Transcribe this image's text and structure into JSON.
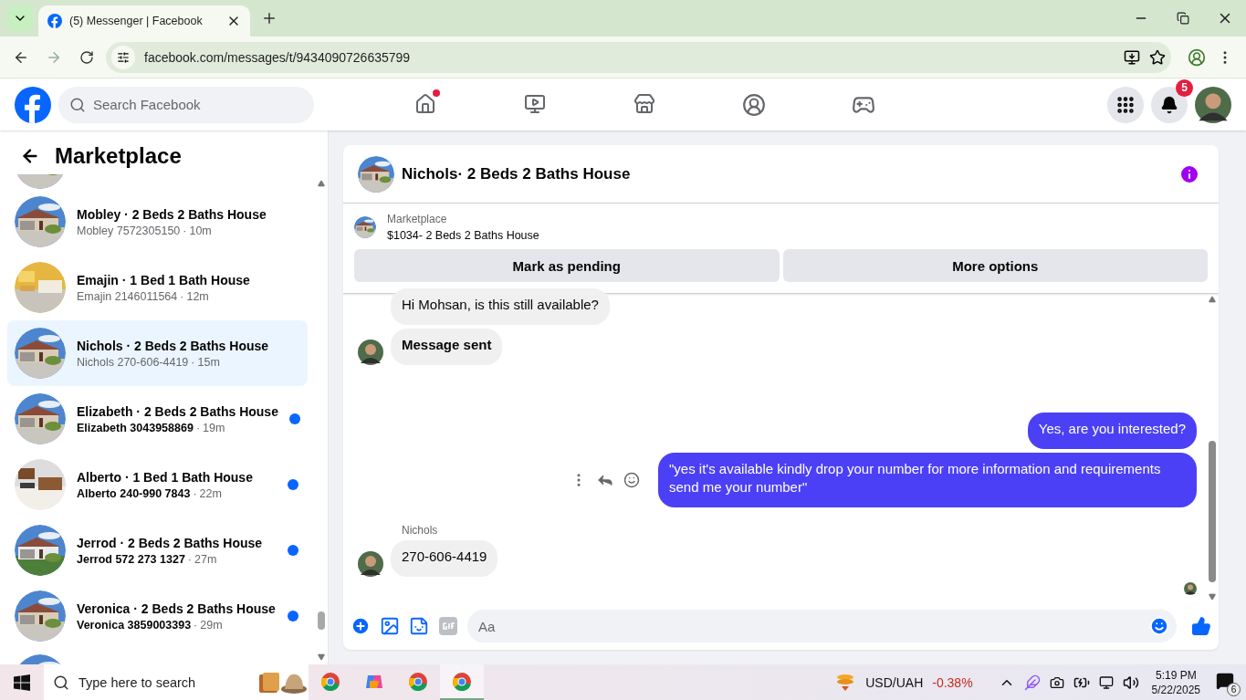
{
  "browser": {
    "tab_title": "(5) Messenger | Facebook",
    "url": "facebook.com/messages/t/9434090726635799"
  },
  "header": {
    "search_placeholder": "Search Facebook",
    "notification_count": "5"
  },
  "sidebar": {
    "title": "Marketplace",
    "conversations": [
      {
        "title": "Mobley · 2 Beds 2 Baths House",
        "subtitle": "Mobley 7572305150",
        "separator": "·",
        "time": "10m",
        "unread": false,
        "selected": false
      },
      {
        "title": "Emajin · 1 Bed 1 Bath House",
        "subtitle": "Emajin 2146011564",
        "separator": "·",
        "time": "12m",
        "unread": false,
        "selected": false
      },
      {
        "title": "Nichols · 2 Beds 2 Baths House",
        "subtitle": "Nichols 270-606-4419",
        "separator": "·",
        "time": "15m",
        "unread": false,
        "selected": true
      },
      {
        "title": "Elizabeth · 2 Beds 2 Baths House",
        "subtitle": "Elizabeth 3043958869",
        "separator": "·",
        "time": "19m",
        "unread": true,
        "selected": false
      },
      {
        "title": "Alberto · 1 Bed 1 Bath House",
        "subtitle": "Alberto 240-990 7843",
        "separator": "·",
        "time": "22m",
        "unread": true,
        "selected": false
      },
      {
        "title": "Jerrod · 2 Beds 2 Baths House",
        "subtitle": "Jerrod 572 273 1327",
        "separator": "·",
        "time": "27m",
        "unread": true,
        "selected": false
      },
      {
        "title": "Veronica · 2 Beds 2 Baths House",
        "subtitle": "Veronica 3859003393",
        "separator": "·",
        "time": "29m",
        "unread": true,
        "selected": false
      }
    ]
  },
  "chat": {
    "title": "Nichols· 2 Beds 2 Baths House",
    "listing": {
      "source": "Marketplace",
      "name": "$1034- 2 Beds 2 Baths House"
    },
    "actions": [
      "Mark as pending",
      "More options"
    ],
    "messages": [
      {
        "kind": "received",
        "text": "Hi Mohsan, is this still available?",
        "strong": false,
        "avatar": false
      },
      {
        "kind": "received",
        "text": "Message sent",
        "strong": true,
        "avatar": true
      },
      {
        "kind": "sent",
        "text": "Yes, are you interested?",
        "strong": false,
        "tools": false
      },
      {
        "kind": "sent",
        "text": "\"yes it's available kindly drop your number for more information and requirements send me your number\"",
        "strong": false,
        "tools": true
      },
      {
        "kind": "received",
        "sender": "Nichols",
        "text": "270-606-4419",
        "strong": false,
        "avatar": true
      }
    ],
    "composer": {
      "placeholder": "Aa"
    }
  },
  "taskbar": {
    "search_placeholder": "Type here to search",
    "ticker": "USD/UAH",
    "change": "-0.38%",
    "time": "5:19 PM",
    "date": "5/22/2025",
    "notification_count": "6"
  }
}
